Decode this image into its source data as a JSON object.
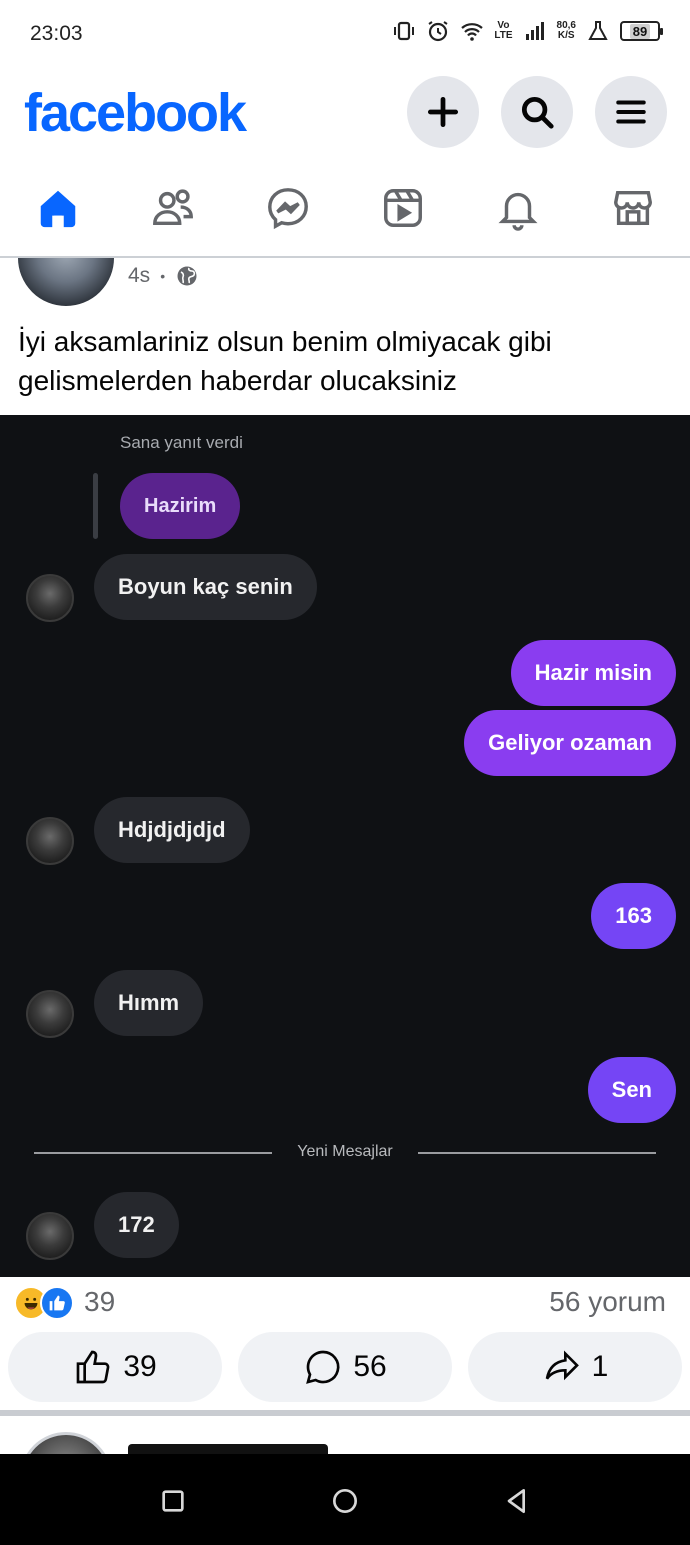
{
  "status_bar": {
    "time": "23:03",
    "volte_top": "Vo",
    "volte_bottom": "LTE",
    "net_speed_value": "80,6",
    "net_speed_unit": "K/S",
    "battery": "89"
  },
  "header": {
    "logo": "facebook",
    "brand_color": "#0866ff"
  },
  "tabs": [
    {
      "name": "home",
      "icon": "home-icon",
      "active": true
    },
    {
      "name": "friends",
      "icon": "friends-icon",
      "active": false
    },
    {
      "name": "messenger",
      "icon": "messenger-icon",
      "active": false
    },
    {
      "name": "video",
      "icon": "video-icon",
      "active": false
    },
    {
      "name": "notifications",
      "icon": "bell-icon",
      "active": false
    },
    {
      "name": "marketplace",
      "icon": "marketplace-icon",
      "active": false
    }
  ],
  "post": {
    "time": "4s",
    "dot": "•",
    "text": "İyi aksamlariniz olsun benim olmiyacak gibi gelismelerden haberdar olucaksiniz"
  },
  "chat": {
    "replied_label": "Sana yanıt verdi",
    "replied_message": "Hazirim",
    "messages": [
      {
        "from": "them",
        "text": "Boyun kaç senin"
      },
      {
        "from": "me",
        "text": "Hazir misin"
      },
      {
        "from": "me",
        "text": "Geliyor ozaman"
      },
      {
        "from": "them",
        "text": "Hdjdjdjdjd"
      },
      {
        "from": "me",
        "text": "163"
      },
      {
        "from": "them",
        "text": "Hımm"
      },
      {
        "from": "me",
        "text": "Sen"
      },
      {
        "from": "them",
        "text": "172"
      }
    ],
    "new_messages_label": "Yeni Mesajlar"
  },
  "reactions": {
    "count": "39",
    "comments": "56 yorum"
  },
  "actions": {
    "like_count": "39",
    "comment_count": "56",
    "share_count": "1"
  }
}
